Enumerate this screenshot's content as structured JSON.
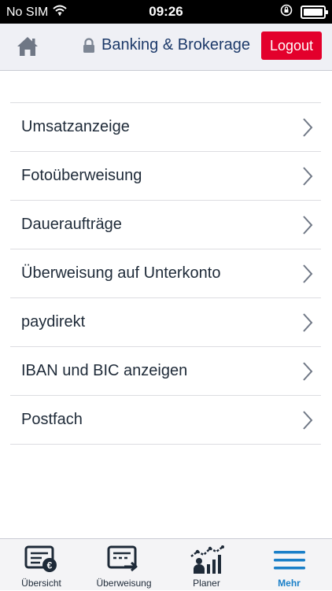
{
  "status": {
    "carrier": "No SIM",
    "time": "09:26"
  },
  "header": {
    "title": "Banking & Brokerage",
    "logout_label": "Logout"
  },
  "menu": {
    "items": [
      {
        "label": "Umsatzanzeige"
      },
      {
        "label": "Fotoüberweisung"
      },
      {
        "label": "Daueraufträge"
      },
      {
        "label": "Überweisung auf Unterkonto"
      },
      {
        "label": "paydirekt"
      },
      {
        "label": "IBAN und BIC anzeigen"
      },
      {
        "label": "Postfach"
      }
    ]
  },
  "tabs": [
    {
      "label": "Übersicht",
      "icon": "overview-card-euro-icon"
    },
    {
      "label": "Überweisung",
      "icon": "transfer-card-arrow-icon"
    },
    {
      "label": "Planer",
      "icon": "planner-chart-icon"
    },
    {
      "label": "Mehr",
      "icon": "menu-lines-icon",
      "active": true
    }
  ],
  "colors": {
    "accent_red": "#e3002c",
    "header_bg": "#eff0f5",
    "title_blue": "#1d3a6a",
    "active_tab": "#1a7fc8"
  }
}
